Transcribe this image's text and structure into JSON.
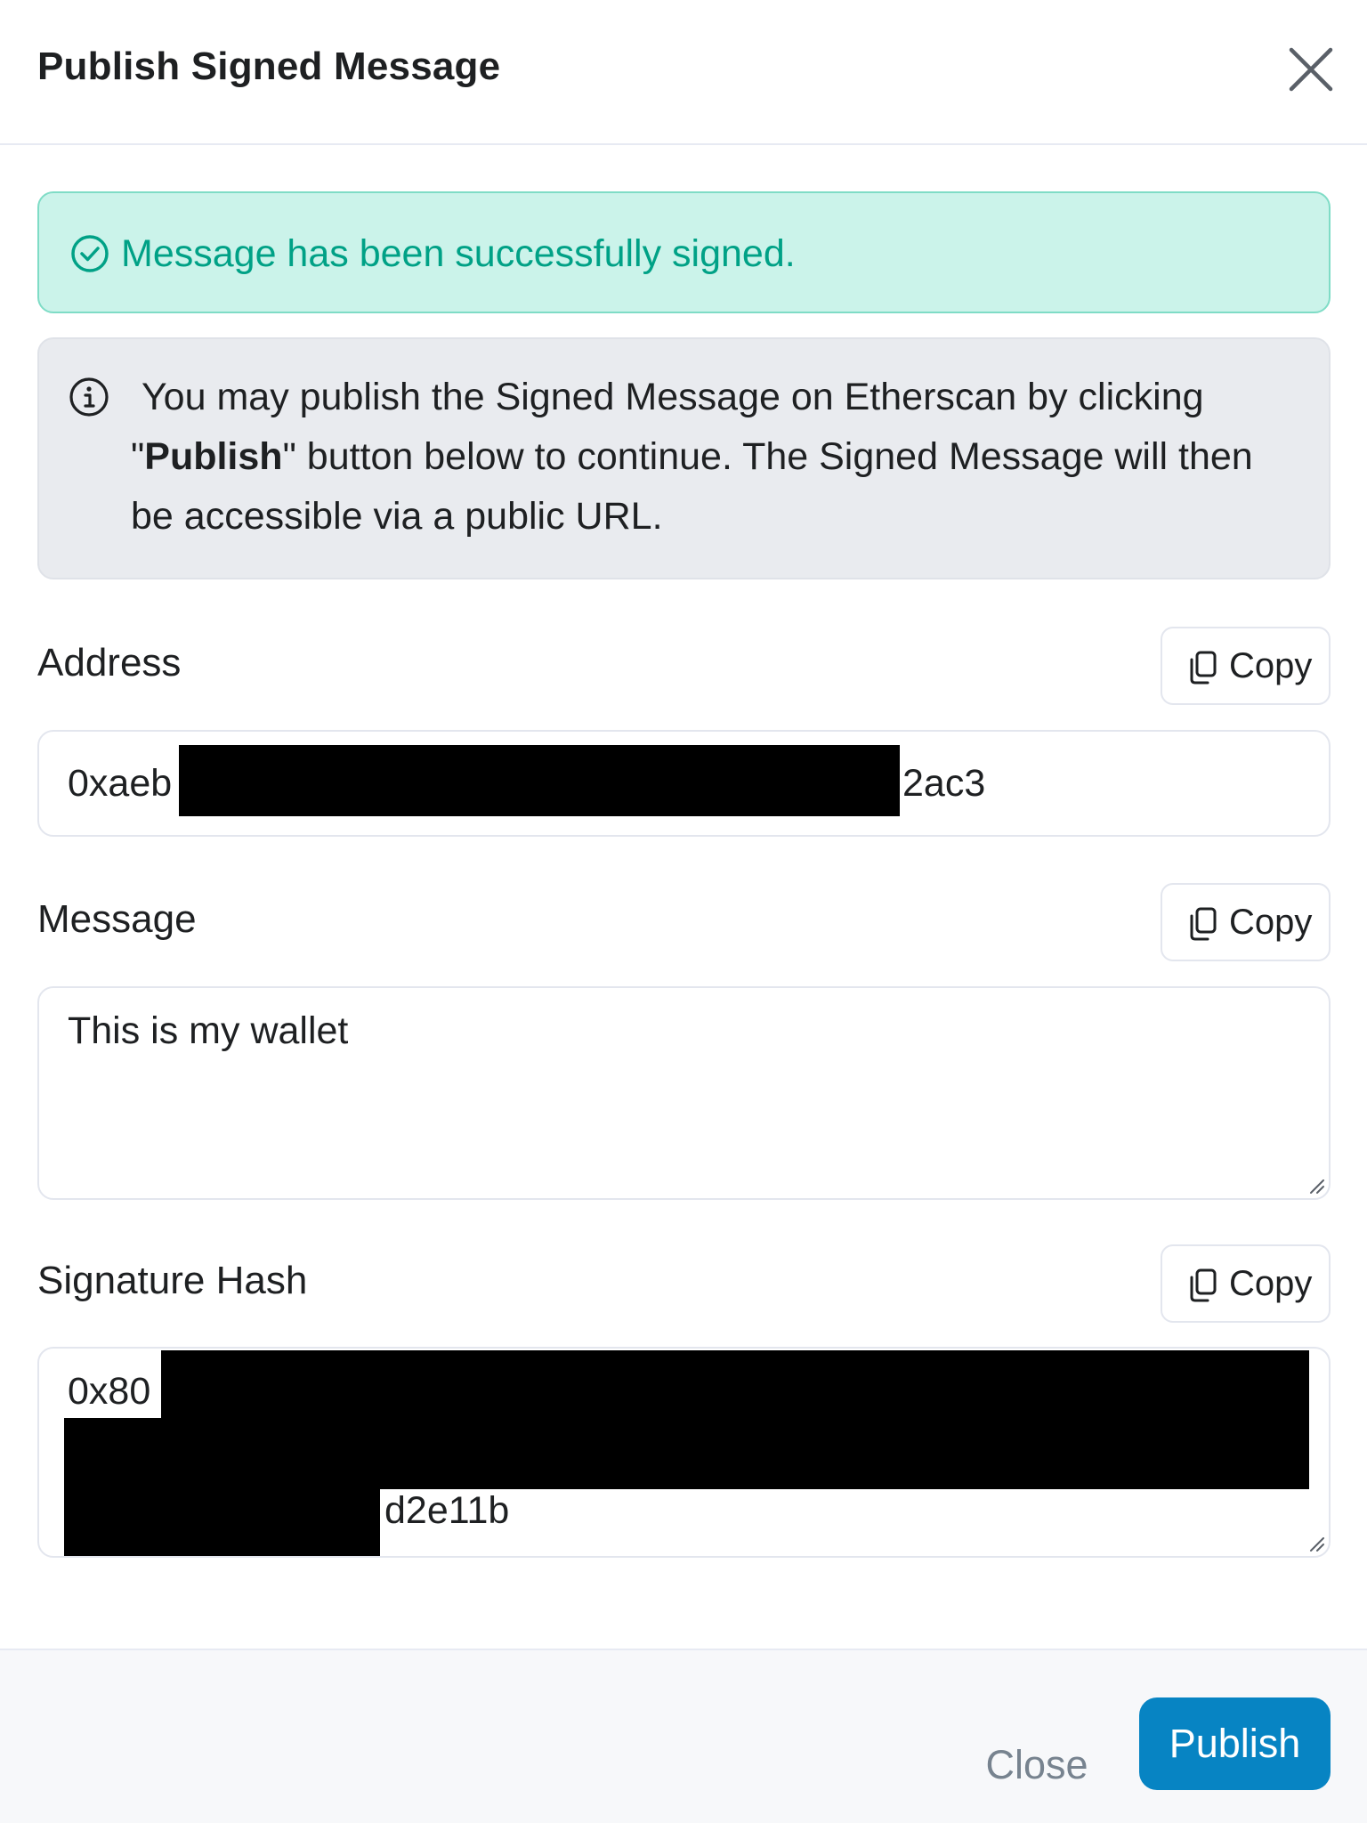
{
  "modal": {
    "title": "Publish Signed Message"
  },
  "success_alert": {
    "text": "Message has been successfully signed."
  },
  "info_alert": {
    "prefix": "You may publish the Signed Message on Etherscan by clicking \"",
    "bold": "Publish",
    "suffix": "\" button below to continue. The Signed Message will then be accessible via a public URL."
  },
  "fields": {
    "address": {
      "label": "Address",
      "copy_label": "Copy",
      "value_start": "0xaeb",
      "value_end": "2ac3"
    },
    "message": {
      "label": "Message",
      "copy_label": "Copy",
      "value": "This is my wallet"
    },
    "signature": {
      "label": "Signature Hash",
      "copy_label": "Copy",
      "value_start": "0x80",
      "value_end": "d2e11b"
    }
  },
  "footer": {
    "close_label": "Close",
    "publish_label": "Publish"
  },
  "colors": {
    "success_bg": "#cbf3ea",
    "success_text": "#00a186",
    "info_bg": "#e9ebef",
    "primary": "#0784c3",
    "muted": "#77838f"
  },
  "icons": {
    "close": "close-icon",
    "success": "check-circle-icon",
    "info": "info-circle-icon",
    "copy": "copy-icon"
  }
}
